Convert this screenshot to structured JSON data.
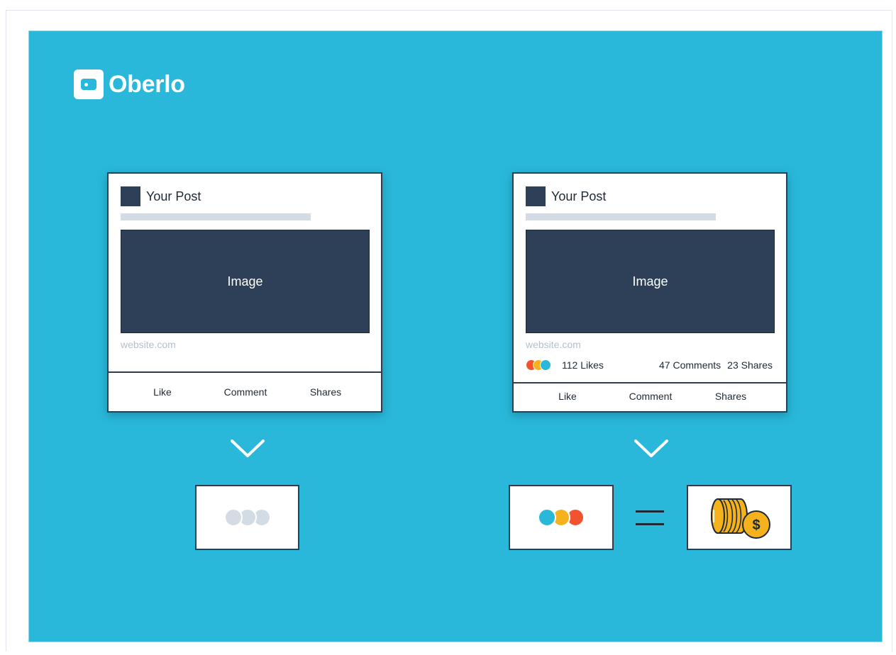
{
  "brand": {
    "name": "Oberlo"
  },
  "colors": {
    "background": "#29b8d9",
    "dark": "#2e4057",
    "placeholder": "#d3dbe5",
    "react_blue": "#29b8d9",
    "react_yellow": "#f5b21c",
    "react_orange": "#f2532e",
    "inactive": "#d3dbe5",
    "coin": "#f5b21c"
  },
  "left_post": {
    "title": "Your Post",
    "image_label": "Image",
    "link": "website.com",
    "actions": [
      "Like",
      "Comment",
      "Shares"
    ]
  },
  "right_post": {
    "title": "Your Post",
    "image_label": "Image",
    "link": "website.com",
    "likes": "112 Likes",
    "comments": "47 Comments",
    "shares": "23 Shares",
    "actions": [
      "Like",
      "Comment",
      "Shares"
    ]
  },
  "icons": [
    "chevron-down-icon",
    "reaction-dots-icon",
    "equals-icon",
    "coins-icon",
    "dollar-icon"
  ]
}
